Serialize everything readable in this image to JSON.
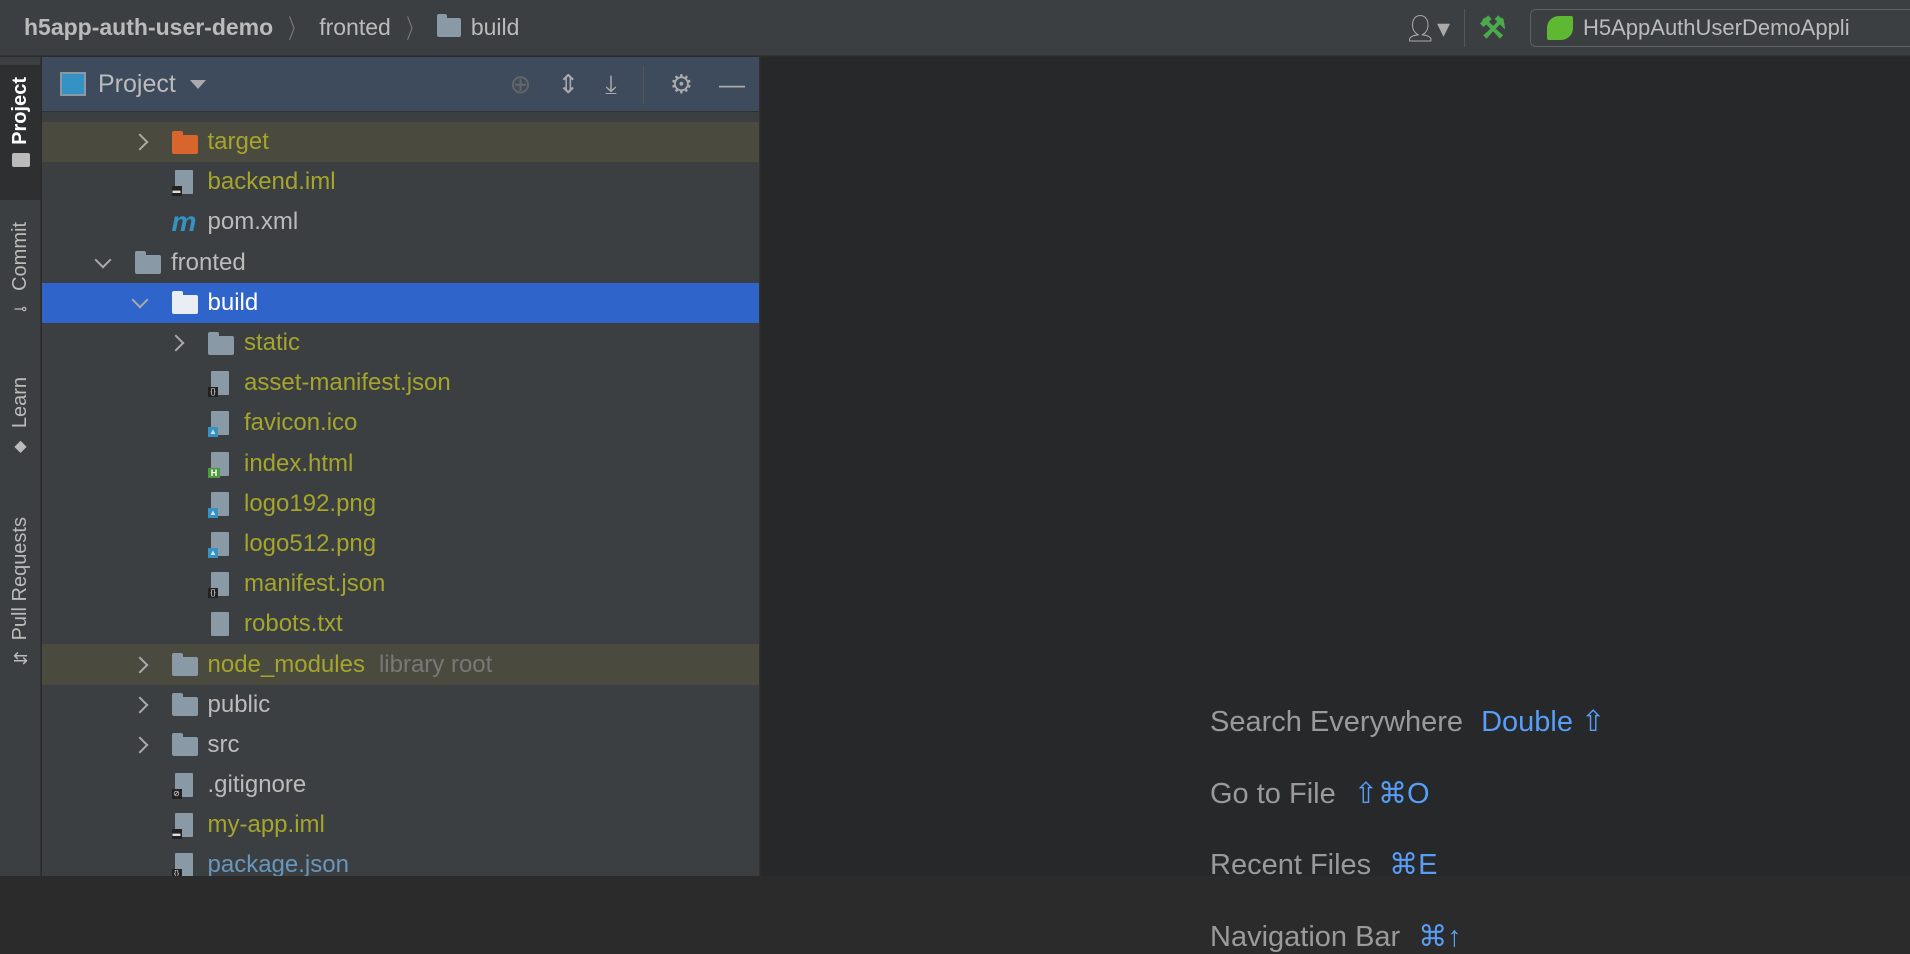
{
  "breadcrumb": {
    "project": "h5app-auth-user-demo",
    "items": [
      "fronted",
      "build"
    ]
  },
  "toolbar": {
    "run_config": "H5AppAuthUserDemoAppli",
    "icons": [
      "user-icon",
      "build-hammer-icon",
      "spring-boot-icon"
    ]
  },
  "side_tabs": [
    "Project",
    "Commit",
    "Learn",
    "Pull Requests"
  ],
  "project_panel": {
    "title": "Project",
    "tools": [
      "locate-icon",
      "expand-all-icon",
      "collapse-all-icon",
      "gear-icon",
      "minimize-icon"
    ]
  },
  "tree": [
    {
      "name": "target",
      "level": 2,
      "type": "folder-orange",
      "chevron": "right",
      "color": "olive",
      "ignored": true
    },
    {
      "name": "backend.iml",
      "level": 2,
      "type": "iml",
      "color": "olive"
    },
    {
      "name": "pom.xml",
      "level": 2,
      "type": "maven",
      "color": "normal"
    },
    {
      "name": "fronted",
      "level": 1,
      "type": "folder",
      "chevron": "down",
      "color": "normal"
    },
    {
      "name": "build",
      "level": 2,
      "type": "folder",
      "chevron": "down",
      "color": "normal",
      "selected": true
    },
    {
      "name": "static",
      "level": 3,
      "type": "folder",
      "chevron": "right",
      "color": "olive"
    },
    {
      "name": "asset-manifest.json",
      "level": 3,
      "type": "json",
      "color": "olive"
    },
    {
      "name": "favicon.ico",
      "level": 3,
      "type": "image",
      "color": "olive"
    },
    {
      "name": "index.html",
      "level": 3,
      "type": "html",
      "color": "olive"
    },
    {
      "name": "logo192.png",
      "level": 3,
      "type": "image",
      "color": "olive"
    },
    {
      "name": "logo512.png",
      "level": 3,
      "type": "image",
      "color": "olive"
    },
    {
      "name": "manifest.json",
      "level": 3,
      "type": "json",
      "color": "olive"
    },
    {
      "name": "robots.txt",
      "level": 3,
      "type": "text",
      "color": "olive"
    },
    {
      "name": "node_modules",
      "extra": "library root",
      "level": 2,
      "type": "folder",
      "chevron": "right",
      "color": "olive",
      "ignored": true
    },
    {
      "name": "public",
      "level": 2,
      "type": "folder",
      "chevron": "right",
      "color": "normal"
    },
    {
      "name": "src",
      "level": 2,
      "type": "folder",
      "chevron": "right",
      "color": "normal"
    },
    {
      "name": ".gitignore",
      "level": 2,
      "type": "ignore",
      "color": "normal"
    },
    {
      "name": "my-app.iml",
      "level": 2,
      "type": "iml",
      "color": "olive"
    },
    {
      "name": "package.json",
      "level": 2,
      "type": "json",
      "color": "blue"
    }
  ],
  "hints": [
    {
      "label": "Search Everywhere",
      "shortcut": "Double ⇧"
    },
    {
      "label": "Go to File",
      "shortcut": "⇧⌘O"
    },
    {
      "label": "Recent Files",
      "shortcut": "⌘E"
    },
    {
      "label": "Navigation Bar",
      "shortcut": "⌘↑"
    }
  ]
}
